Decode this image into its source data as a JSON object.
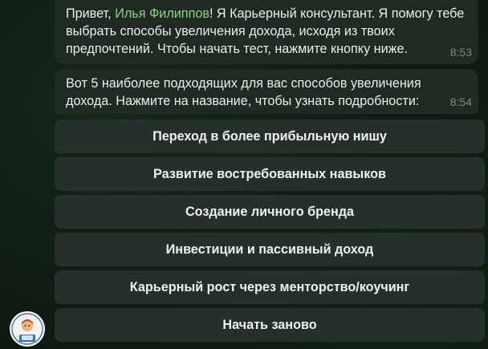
{
  "messages": [
    {
      "text_before": "Привет, ",
      "name": "Илья Филиппов",
      "text_after": "! Я Карьерный консультант. Я помогу тебе выбрать способы увеличения дохода, исходя из твоих предпочтений. Чтобы начать тест, нажмите кнопку ниже.",
      "time": "8:53"
    },
    {
      "text": "Вот 5 наиболее подходящих для вас способов увеличения дохода. Нажмите на название, чтобы узнать подробности:",
      "time": "8:54"
    }
  ],
  "keyboard": [
    {
      "label": "Переход в более прибыльную нишу"
    },
    {
      "label": "Развитие востребованных навыков"
    },
    {
      "label": "Создание личного бренда"
    },
    {
      "label": "Инвестиции и пассивный доход"
    },
    {
      "label": "Карьерный рост через менторство/коучинг"
    },
    {
      "label": "Начать заново"
    }
  ],
  "avatar": {
    "icon": "bot-avatar-icon"
  },
  "colors": {
    "bubble": "#1f2a22",
    "button": "#26302a",
    "name": "#8fd18a",
    "time": "#7d8a80"
  }
}
